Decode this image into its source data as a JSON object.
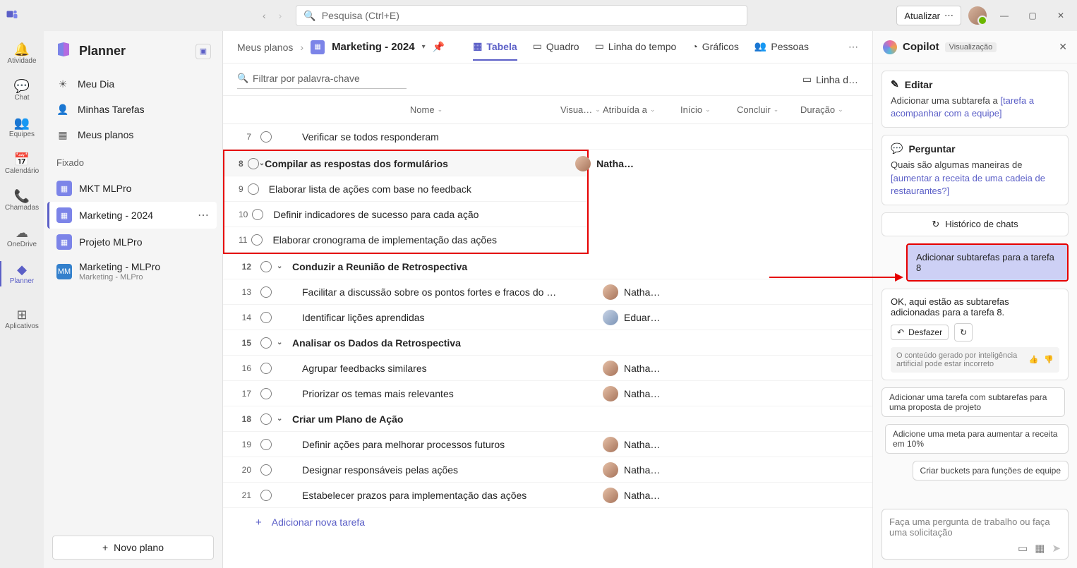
{
  "titlebar": {
    "search_placeholder": "Pesquisa (Ctrl+E)",
    "update_label": "Atualizar"
  },
  "rail": {
    "items": [
      {
        "name": "activity",
        "label": "Atividade",
        "glyph": "🔔"
      },
      {
        "name": "chat",
        "label": "Chat",
        "glyph": "💬"
      },
      {
        "name": "teams",
        "label": "Equipes",
        "glyph": "👥"
      },
      {
        "name": "calendar",
        "label": "Calendário",
        "glyph": "📅"
      },
      {
        "name": "calls",
        "label": "Chamadas",
        "glyph": "📞"
      },
      {
        "name": "onedrive",
        "label": "OneDrive",
        "glyph": "☁"
      },
      {
        "name": "planner",
        "label": "Planner",
        "glyph": "◆"
      },
      {
        "name": "apps",
        "label": "Aplicativos",
        "glyph": "⊞"
      }
    ],
    "active": "planner"
  },
  "sidebar": {
    "title": "Planner",
    "nav": [
      {
        "name": "myday",
        "label": "Meu Dia",
        "glyph": "☀"
      },
      {
        "name": "mytasks",
        "label": "Minhas Tarefas",
        "glyph": "👤"
      },
      {
        "name": "myplans",
        "label": "Meus planos",
        "glyph": "▦"
      }
    ],
    "pinned_label": "Fixado",
    "plans": [
      {
        "name": "mkt-mlpro",
        "label": "MKT MLPro",
        "color": "#7c84e8",
        "icon": "▦"
      },
      {
        "name": "marketing-2024",
        "label": "Marketing - 2024",
        "color": "#7c84e8",
        "icon": "▦",
        "active": true
      },
      {
        "name": "projeto-mlpro",
        "label": "Projeto MLPro",
        "color": "#7c84e8",
        "icon": "▦"
      },
      {
        "name": "marketing-mlpro",
        "label": "Marketing - MLPro",
        "sub": "Marketing - MLPro",
        "color": "#3380cc",
        "icon": "MM"
      }
    ],
    "new_plan_label": "Novo plano"
  },
  "header": {
    "crumb_root": "Meus planos",
    "plan_name": "Marketing - 2024",
    "views": [
      {
        "name": "table",
        "label": "Tabela",
        "glyph": "▦",
        "active": true
      },
      {
        "name": "board",
        "label": "Quadro",
        "glyph": "▭"
      },
      {
        "name": "timeline",
        "label": "Linha do tempo",
        "glyph": "▭"
      },
      {
        "name": "charts",
        "label": "Gráficos",
        "glyph": "◔"
      },
      {
        "name": "people",
        "label": "Pessoas",
        "glyph": "👥"
      }
    ]
  },
  "filter": {
    "placeholder": "Filtrar por palavra-chave",
    "layout_label": "Linha d…"
  },
  "columns": {
    "name": "Nome",
    "visual": "Visua…",
    "assigned": "Atribuída a",
    "start": "Início",
    "end": "Concluir",
    "duration": "Duração"
  },
  "rows": [
    {
      "num": "7",
      "type": "child",
      "name": "Verificar se todos responderam"
    },
    {
      "num": "8",
      "type": "parent",
      "name": "Compilar as respostas dos formulários",
      "assignee": "Natha…",
      "hl": true
    },
    {
      "num": "9",
      "type": "child",
      "name": "Elaborar lista de ações com base no feedback",
      "hl": true
    },
    {
      "num": "10",
      "type": "child",
      "name": "Definir indicadores de sucesso para cada ação",
      "hl": true
    },
    {
      "num": "11",
      "type": "child",
      "name": "Elaborar cronograma de implementação das ações",
      "hl": true
    },
    {
      "num": "12",
      "type": "parent",
      "name": "Conduzir a Reunião de Retrospectiva"
    },
    {
      "num": "13",
      "type": "child",
      "name": "Facilitar a discussão sobre os pontos fortes e fracos do proje...",
      "assignee": "Natha…"
    },
    {
      "num": "14",
      "type": "child",
      "name": "Identificar lições aprendidas",
      "assignee": "Eduar…",
      "avclass": "m"
    },
    {
      "num": "15",
      "type": "parent",
      "name": "Analisar os Dados da Retrospectiva"
    },
    {
      "num": "16",
      "type": "child",
      "name": "Agrupar feedbacks similares",
      "assignee": "Natha…"
    },
    {
      "num": "17",
      "type": "child",
      "name": "Priorizar os temas mais relevantes",
      "assignee": "Natha…"
    },
    {
      "num": "18",
      "type": "parent",
      "name": "Criar um Plano de Ação"
    },
    {
      "num": "19",
      "type": "child",
      "name": "Definir ações para melhorar processos futuros",
      "assignee": "Natha…"
    },
    {
      "num": "20",
      "type": "child",
      "name": "Designar responsáveis pelas ações",
      "assignee": "Natha…"
    },
    {
      "num": "21",
      "type": "child",
      "name": "Estabelecer prazos para implementação das ações",
      "assignee": "Natha…"
    }
  ],
  "add_task_label": "Adicionar nova tarefa",
  "copilot": {
    "title": "Copilot",
    "badge": "Visualização",
    "edit": {
      "heading": "Editar",
      "body_pre": "Adicionar uma subtarefa a ",
      "body_link": "[tarefa a acompanhar com a equipe]"
    },
    "ask": {
      "heading": "Perguntar",
      "body_pre": "Quais são algumas maneiras de ",
      "body_link": "[aumentar a receita de uma cadeia de restaurantes?]"
    },
    "history_label": "Histórico de chats",
    "user_message": "Adicionar subtarefas para a tarefa 8",
    "response": "OK, aqui estão as subtarefas adicionadas para a tarefa 8.",
    "undo_label": "Desfazer",
    "disclaimer": "O conteúdo gerado por inteligência artificial pode estar incorreto",
    "suggestions": [
      "Adicionar uma tarefa com subtarefas para uma proposta de projeto",
      "Adicione uma meta para aumentar a receita em 10%",
      "Criar buckets para funções de equipe"
    ],
    "input_placeholder": "Faça uma pergunta de trabalho ou faça uma solicitação"
  }
}
